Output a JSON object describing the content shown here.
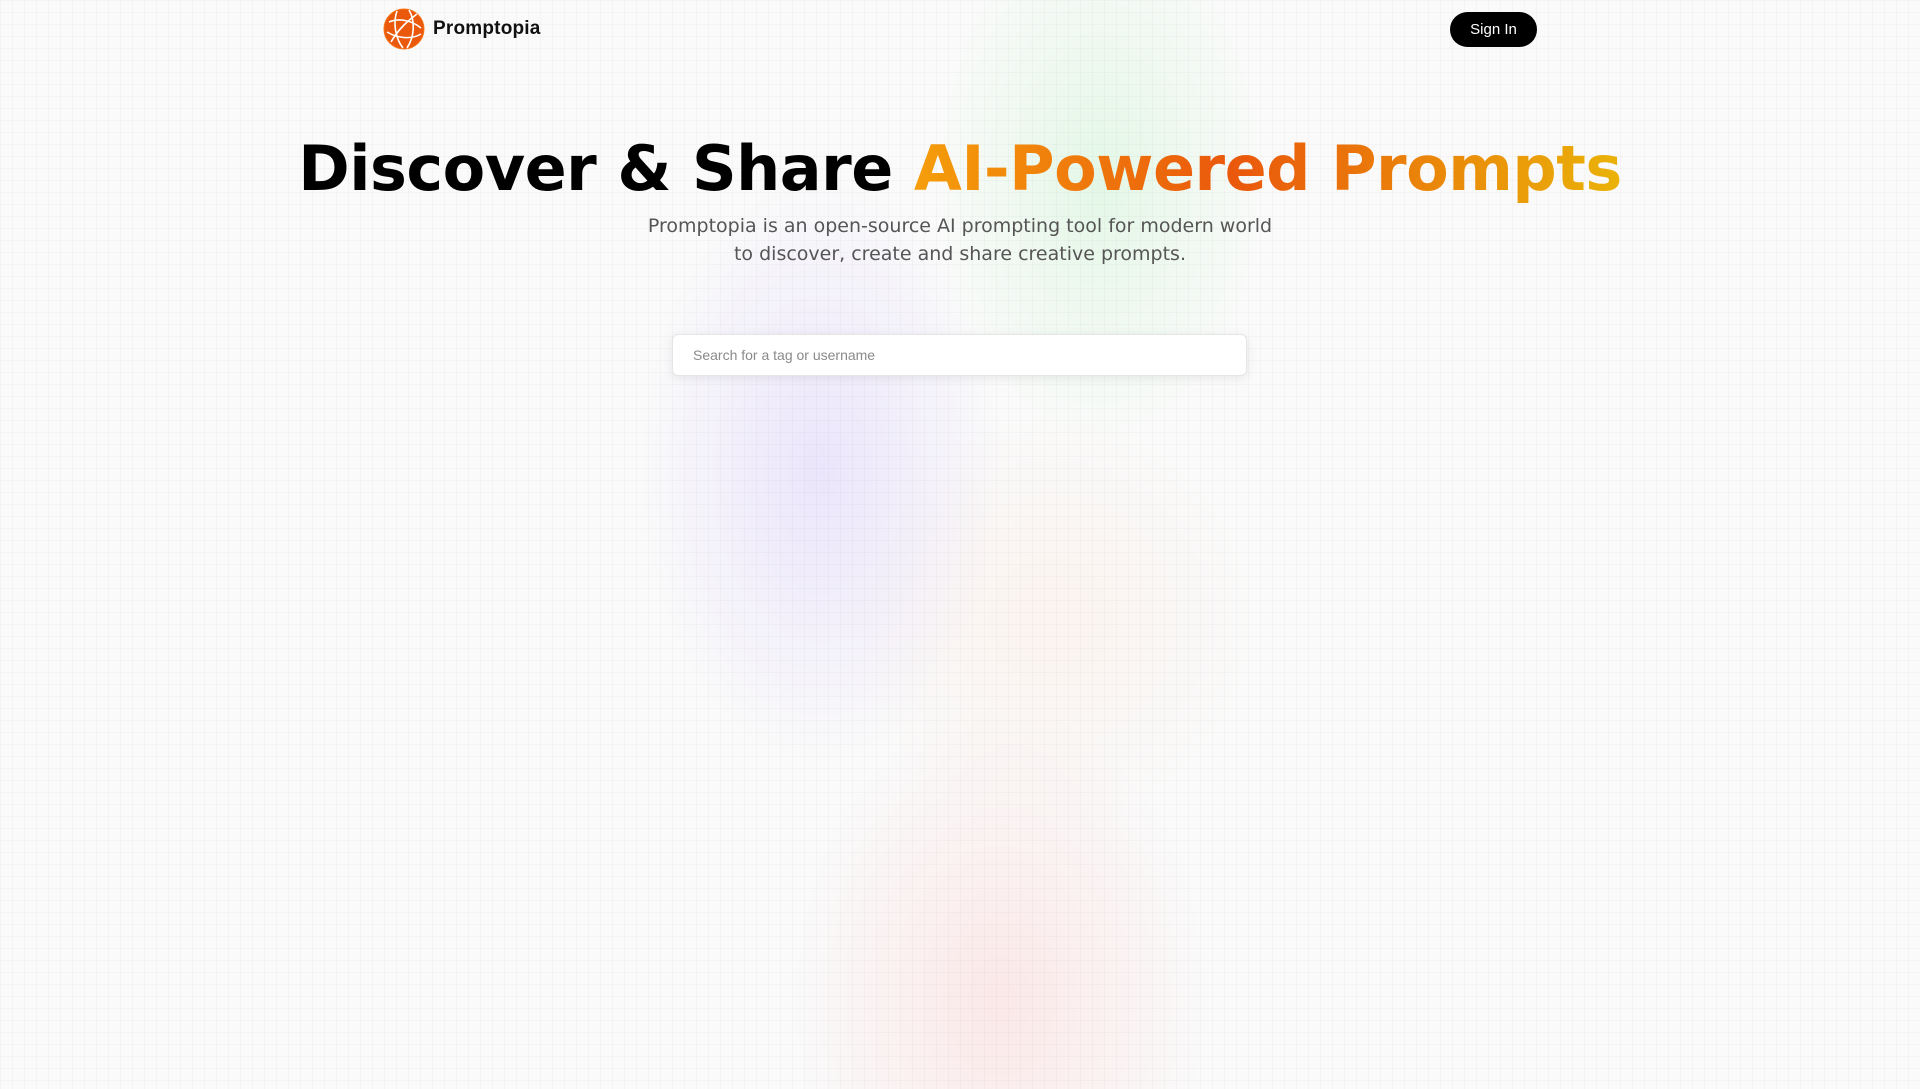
{
  "header": {
    "brand_name": "Promptopia",
    "logo_icon": "globe-logo-icon",
    "sign_in_label": "Sign In"
  },
  "hero": {
    "headline_main": "Discover & Share",
    "headline_accent": "AI-Powered Prompts",
    "description": "Promptopia is an open-source AI prompting tool for modern world to discover, create and share creative prompts."
  },
  "search": {
    "value": "",
    "placeholder": "Search for a tag or username"
  },
  "colors": {
    "accent_gradient": [
      "#f59e0b",
      "#ea580c",
      "#eab308"
    ],
    "logo": "#ea580c",
    "button_bg": "#000000"
  }
}
